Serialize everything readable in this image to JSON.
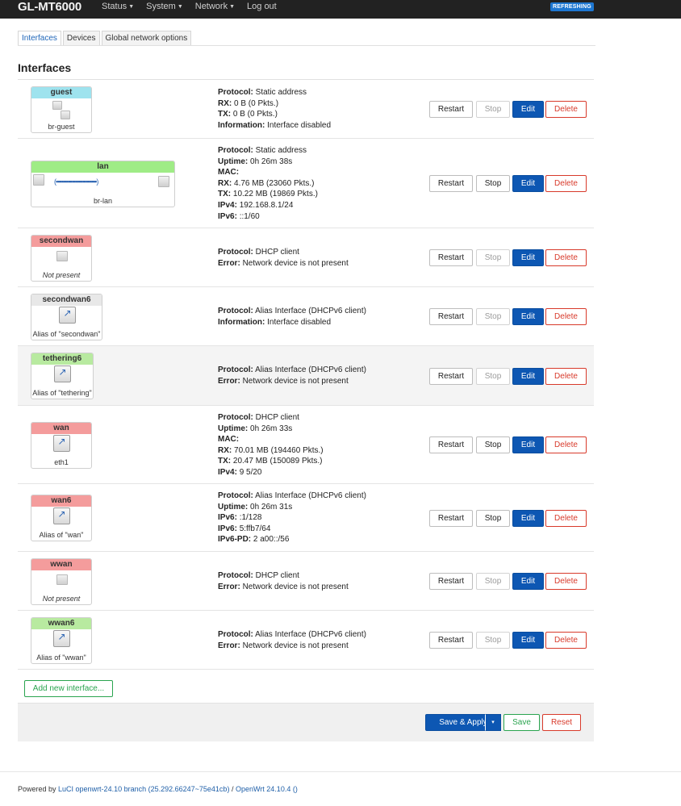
{
  "header": {
    "brand": "GL-MT6000",
    "menus": [
      "Status",
      "System",
      "Network",
      "Log out"
    ],
    "refresh_badge": "REFRESHING"
  },
  "tabs": [
    "Interfaces",
    "Devices",
    "Global network options"
  ],
  "section_title": "Interfaces",
  "buttons": {
    "restart": "Restart",
    "stop": "Stop",
    "edit": "Edit",
    "delete": "Delete"
  },
  "interfaces": [
    {
      "name": "guest",
      "sub": "br-guest",
      "header_color": "#9ee3ee",
      "lines": [
        {
          "k": "Protocol:",
          "v": "Static address"
        },
        {
          "k": "RX:",
          "v": "0 B (0 Pkts.)"
        },
        {
          "k": "TX:",
          "v": "0 B (0 Pkts.)"
        },
        {
          "k": "Information:",
          "v": "Interface disabled"
        }
      ]
    },
    {
      "name": "lan",
      "sub": "br-lan",
      "header_color": "#9fec86",
      "lines": [
        {
          "k": "Protocol:",
          "v": "Static address"
        },
        {
          "k": "Uptime:",
          "v": "0h 26m 38s"
        },
        {
          "k": "MAC:",
          "v": ""
        },
        {
          "k": "RX:",
          "v": "4.76 MB (23060 Pkts.)"
        },
        {
          "k": "TX:",
          "v": "10.22 MB (19869 Pkts.)"
        },
        {
          "k": "IPv4:",
          "v": "192.168.8.1/24"
        },
        {
          "k": "IPv6:",
          "v": "::1/60"
        }
      ]
    },
    {
      "name": "secondwan",
      "sub": "Not present",
      "header_color": "#f49c9c",
      "lines": [
        {
          "k": "Protocol:",
          "v": "DHCP client"
        },
        {
          "k": "Error:",
          "v": "Network device is not present"
        }
      ]
    },
    {
      "name": "secondwan6",
      "sub": "Alias of \"secondwan\"",
      "header_color": "#e8e8e8",
      "lines": [
        {
          "k": "Protocol:",
          "v": "Alias Interface (DHCPv6 client)"
        },
        {
          "k": "Information:",
          "v": "Interface disabled"
        }
      ]
    },
    {
      "name": "tethering6",
      "sub": "Alias of \"tethering\"",
      "header_color": "#b8eaa0",
      "lines": [
        {
          "k": "Protocol:",
          "v": "Alias Interface (DHCPv6 client)"
        },
        {
          "k": "Error:",
          "v": "Network device is not present"
        }
      ]
    },
    {
      "name": "wan",
      "sub": "eth1",
      "header_color": "#f49c9c",
      "lines": [
        {
          "k": "Protocol:",
          "v": "DHCP client"
        },
        {
          "k": "Uptime:",
          "v": "0h 26m 33s"
        },
        {
          "k": "MAC:",
          "v": ""
        },
        {
          "k": "RX:",
          "v": "70.01 MB (194460 Pkts.)"
        },
        {
          "k": "TX:",
          "v": "20.47 MB (150089 Pkts.)"
        },
        {
          "k": "IPv4:",
          "v": "9 5/20"
        }
      ]
    },
    {
      "name": "wan6",
      "sub": "Alias of \"wan\"",
      "header_color": "#f49c9c",
      "lines": [
        {
          "k": "Protocol:",
          "v": "Alias Interface (DHCPv6 client)"
        },
        {
          "k": "Uptime:",
          "v": "0h 26m 31s"
        },
        {
          "k": "IPv6:",
          "v": ":1/128"
        },
        {
          "k": "IPv6:",
          "v": "5:ffb7/64"
        },
        {
          "k": "IPv6-PD:",
          "v": "2 a00::/56"
        }
      ]
    },
    {
      "name": "wwan",
      "sub": "Not present",
      "header_color": "#f49c9c",
      "lines": [
        {
          "k": "Protocol:",
          "v": "DHCP client"
        },
        {
          "k": "Error:",
          "v": "Network device is not present"
        }
      ]
    },
    {
      "name": "wwan6",
      "sub": "Alias of \"wwan\"",
      "header_color": "#b8eaa0",
      "lines": [
        {
          "k": "Protocol:",
          "v": "Alias Interface (DHCPv6 client)"
        },
        {
          "k": "Error:",
          "v": "Network device is not present"
        }
      ]
    }
  ],
  "add_interface": "Add new interface...",
  "footer_actions": {
    "save_apply": "Save & Apply",
    "dropdown": "▾",
    "save": "Save",
    "reset": "Reset"
  },
  "powered_by": {
    "prefix": "Powered by ",
    "luci": "LuCI openwrt-24.10 branch (25.292.66247~75e41cb)",
    "sep": " / ",
    "openwrt": "OpenWrt 24.10.4 ()"
  }
}
